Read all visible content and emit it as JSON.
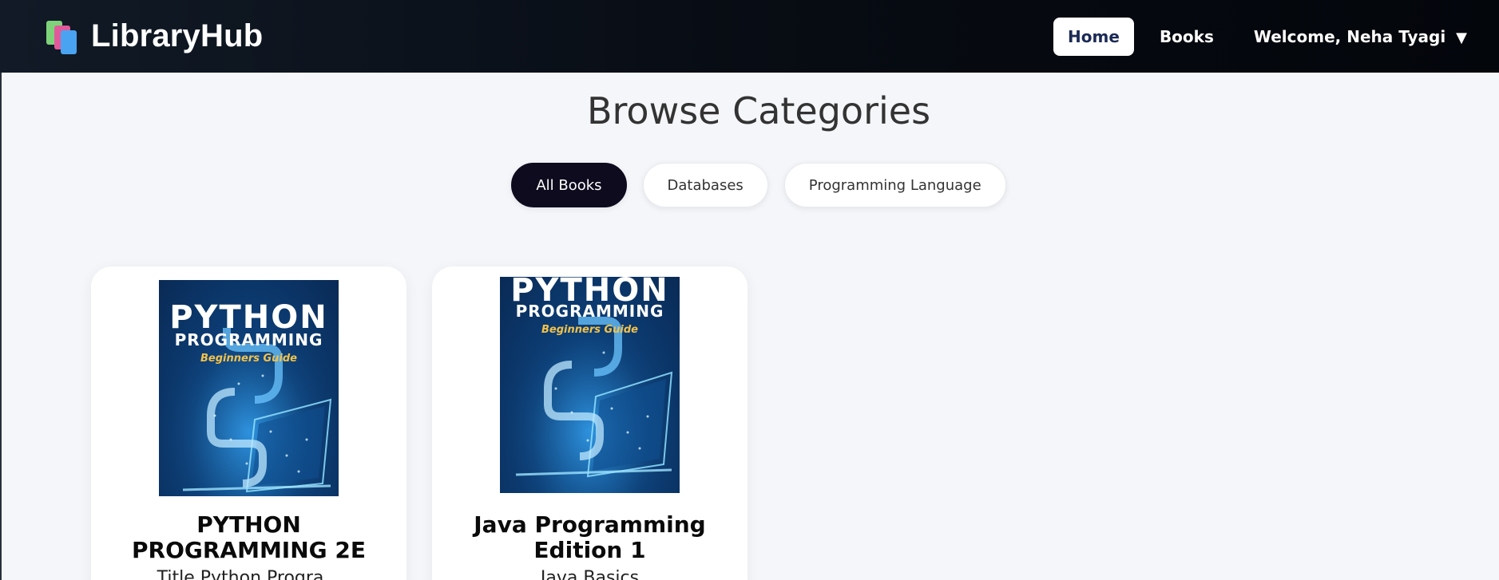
{
  "header": {
    "brand": "LibraryHub",
    "nav": [
      {
        "label": "Home",
        "active": true
      },
      {
        "label": "Books",
        "active": false
      }
    ],
    "user_menu": "Welcome, Neha Tyagi",
    "caret": "▼"
  },
  "main": {
    "title": "Browse Categories",
    "categories": [
      {
        "label": "All Books",
        "active": true
      },
      {
        "label": "Databases",
        "active": false
      },
      {
        "label": "Programming Language",
        "active": false
      }
    ],
    "books": [
      {
        "title": "PYTHON PROGRAMMING 2E",
        "description": "Title Python Progra...",
        "cover": {
          "line1": "PYTHON",
          "line2": "PROGRAMMING",
          "line3": "Beginners Guide"
        }
      },
      {
        "title": "Java Programming Edition 1",
        "description": "Java Basics",
        "cover": {
          "line1": "PYTHON",
          "line2": "PROGRAMMING",
          "line3": "Beginners Guide"
        }
      }
    ]
  },
  "colors": {
    "header_bg": "#070b12",
    "accent_active_pill": "#0e0b1e",
    "active_nav_text": "#1b2a55",
    "cover_highlight": "#f2c14a"
  },
  "icons": {
    "logo": "stacked-books-icon",
    "caret": "caret-down-icon"
  }
}
